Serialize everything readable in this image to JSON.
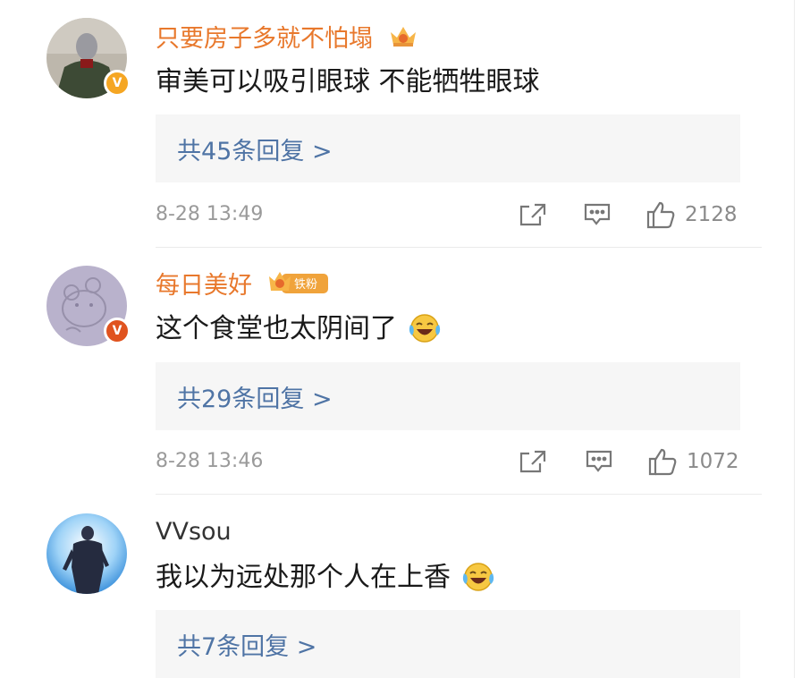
{
  "comments": [
    {
      "username": "只要房子多就不怕塌",
      "username_color": "#e8782c",
      "verified_color": "#f5a623",
      "avatar_icon": "person-in-coat-avatar",
      "badge_icon": "vip-crown-icon",
      "text": "审美可以吸引眼球 不能牺牲眼球",
      "reply_label": "共45条回复 >",
      "time": "8-28 13:49",
      "likes": "2128"
    },
    {
      "username": "每日美好",
      "username_color": "#e8782c",
      "verified_color": "#e0531f",
      "avatar_icon": "cartoon-bear-avatar",
      "badge_icon": "vip-iron-fan-badge",
      "badge_text": "铁粉",
      "text": "这个食堂也太阴间了",
      "emoji": "laughing-crying-emoji",
      "reply_label": "共29条回复 >",
      "time": "8-28 13:46",
      "likes": "1072"
    },
    {
      "username": "VVsou",
      "username_color": "#333333",
      "avatar_icon": "man-in-suit-avatar",
      "text": "我以为远处那个人在上香",
      "emoji": "laughing-crying-emoji",
      "reply_label": "共7条回复 >"
    }
  ],
  "icons": {
    "share": "share-icon",
    "comment": "comment-icon",
    "like": "thumbs-up-icon"
  }
}
